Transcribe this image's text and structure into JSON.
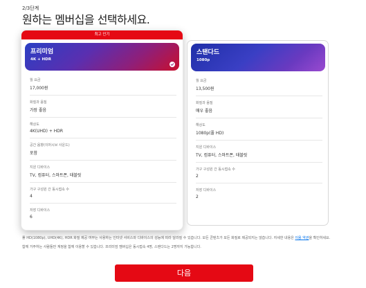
{
  "header": {
    "step": "2/3단계",
    "title": "원하는 멤버십을 선택하세요."
  },
  "colors": {
    "brand_red": "#e50914",
    "link_blue": "#0071eb"
  },
  "plans": [
    {
      "badge": "최고 인기",
      "name": "프리미엄",
      "resolution": "4K + HDR",
      "selected": true,
      "selected_icon": "check-icon",
      "rows": [
        {
          "label": "월 요금",
          "value": "17,000원"
        },
        {
          "label": "화질과 음질",
          "value": "가장 좋음"
        },
        {
          "label": "해상도",
          "value": "4K(UHD) + HDR"
        },
        {
          "label": "공간 음향(이머시브 사운드)",
          "value": "포함"
        },
        {
          "label": "지원 디바이스",
          "value": "TV, 컴퓨터, 스마트폰, 태블릿"
        },
        {
          "label": "가구 구성원 간 동시접속 수",
          "value": "4"
        },
        {
          "label": "저장 디바이스",
          "value": "6"
        }
      ]
    },
    {
      "name": "스탠다드",
      "resolution": "1080p",
      "selected": false,
      "rows": [
        {
          "label": "월 요금",
          "value": "13,500원"
        },
        {
          "label": "화질과 음질",
          "value": "매우 좋음"
        },
        {
          "label": "해상도",
          "value": "1080p(풀 HD)"
        },
        {
          "label": "지원 디바이스",
          "value": "TV, 컴퓨터, 스마트폰, 태블릿"
        },
        {
          "label": "가구 구성원 간 동시접속 수",
          "value": "2"
        },
        {
          "label": "저장 디바이스",
          "value": "2"
        }
      ]
    }
  ],
  "notes": {
    "line1_before_link": "풀 HD(1080p), UHD(4K), HDR 화질 제공 여부는 사용하는 인터넷 서비스와 디바이스의 성능에 따라 달라질 수 있습니다. 모든 콘텐츠가 모든 화질로 제공되지는 않습니다. 자세한 내용은 ",
    "link": "이용 약관",
    "line1_after_link": "을 확인하세요.",
    "line2": "함께 거주하는 사람들만 계정을 함께 이용할 수 있습니다. 프리미엄 멤버십은 동시접속 4명, 스탠다드는 2명까지 가능합니다."
  },
  "next_button": {
    "label": "다음"
  }
}
